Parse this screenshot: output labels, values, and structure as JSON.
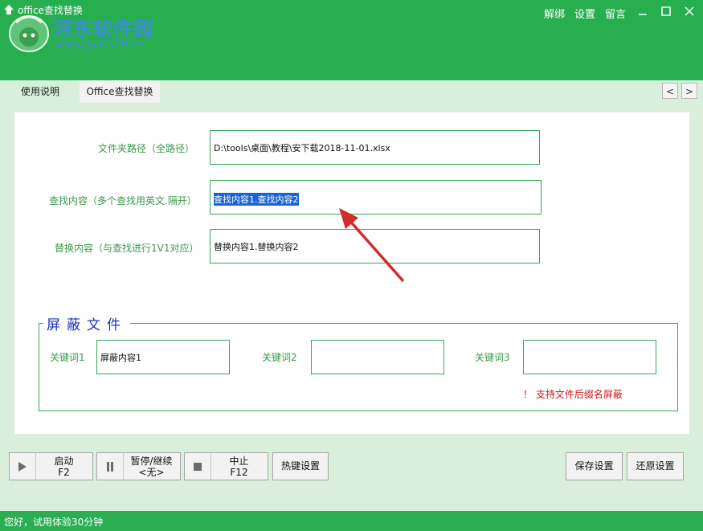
{
  "window": {
    "title": "office查找替换",
    "menu": [
      "解绑",
      "设置",
      "留言"
    ],
    "icons": [
      "minimize-icon",
      "maximize-icon",
      "close-icon"
    ]
  },
  "watermark": {
    "line1": "河东软件园",
    "line2": "www.pc0359.cn"
  },
  "tabs": [
    "使用说明",
    "Office查找替换"
  ],
  "nav": {
    "prev": "<",
    "next": ">"
  },
  "form": {
    "folder_label": "文件夹路径（全路径）",
    "folder_value": "D:\\tools\\桌面\\教程\\安下载2018-11-01.xlsx",
    "find_label": "查找内容（多个查找用英文.隔开）",
    "find_value": "查找内容1.查找内容2",
    "replace_label": "替换内容（与查找进行1V1对应）",
    "replace_value": "替换内容1.替换内容2"
  },
  "shield": {
    "title": "屏蔽文件",
    "kw1_label": "关键词1",
    "kw1_value": "屏蔽内容1",
    "kw2_label": "关键词2",
    "kw2_value": "",
    "kw3_label": "关键词3",
    "kw3_value": "",
    "note": "！ 支持文件后缀名屏蔽"
  },
  "controls": {
    "start": {
      "label": "启动",
      "key": "F2"
    },
    "pause": {
      "label": "暂停/继续",
      "key": "<无>"
    },
    "stop": {
      "label": "中止",
      "key": "F12"
    },
    "hotkey": "热键设置",
    "save": "保存设置",
    "restore": "还原设置"
  },
  "status": "您好，试用体验30分钟",
  "colors": {
    "titlebar": "#27ae4f",
    "accent_green": "#3aa55a",
    "label_green": "#3a9a4a",
    "selection": "#1a63d6",
    "note_red": "#d01818",
    "group_title": "#1830c8"
  }
}
